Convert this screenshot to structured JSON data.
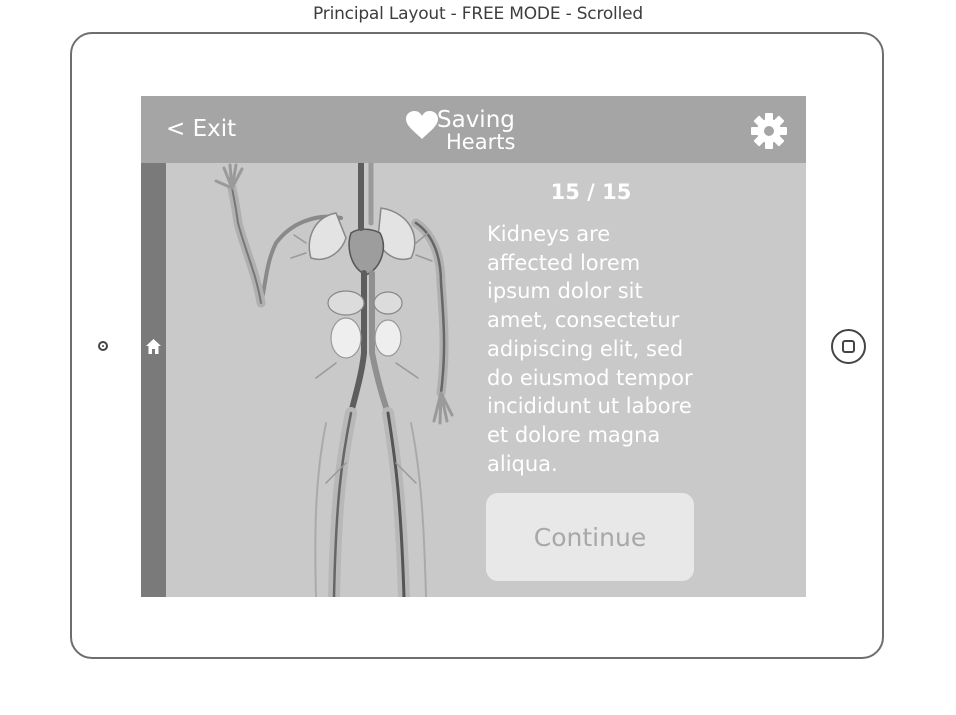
{
  "caption": "Principal Layout - FREE MODE - Scrolled",
  "header": {
    "exit_label": "< Exit",
    "logo_line1": "Saving",
    "logo_line2": "Hearts",
    "settings_icon": "gear-icon"
  },
  "sidebar": {
    "home_icon": "home-icon"
  },
  "content": {
    "counter": "15 / 15",
    "description": "Kidneys are affected lorem ipsum dolor sit amet, consectetur adipiscing elit, sed do eiusmod tempor incididunt ut labore et dolore magna aliqua.",
    "continue_label": "Continue"
  },
  "colors": {
    "screen_bg": "#c9c9c9",
    "topbar_bg": "#a5a5a5",
    "sidebar_bg": "#7a7a7a",
    "button_bg": "#e8e8e8",
    "button_text": "#a8a8a8"
  }
}
